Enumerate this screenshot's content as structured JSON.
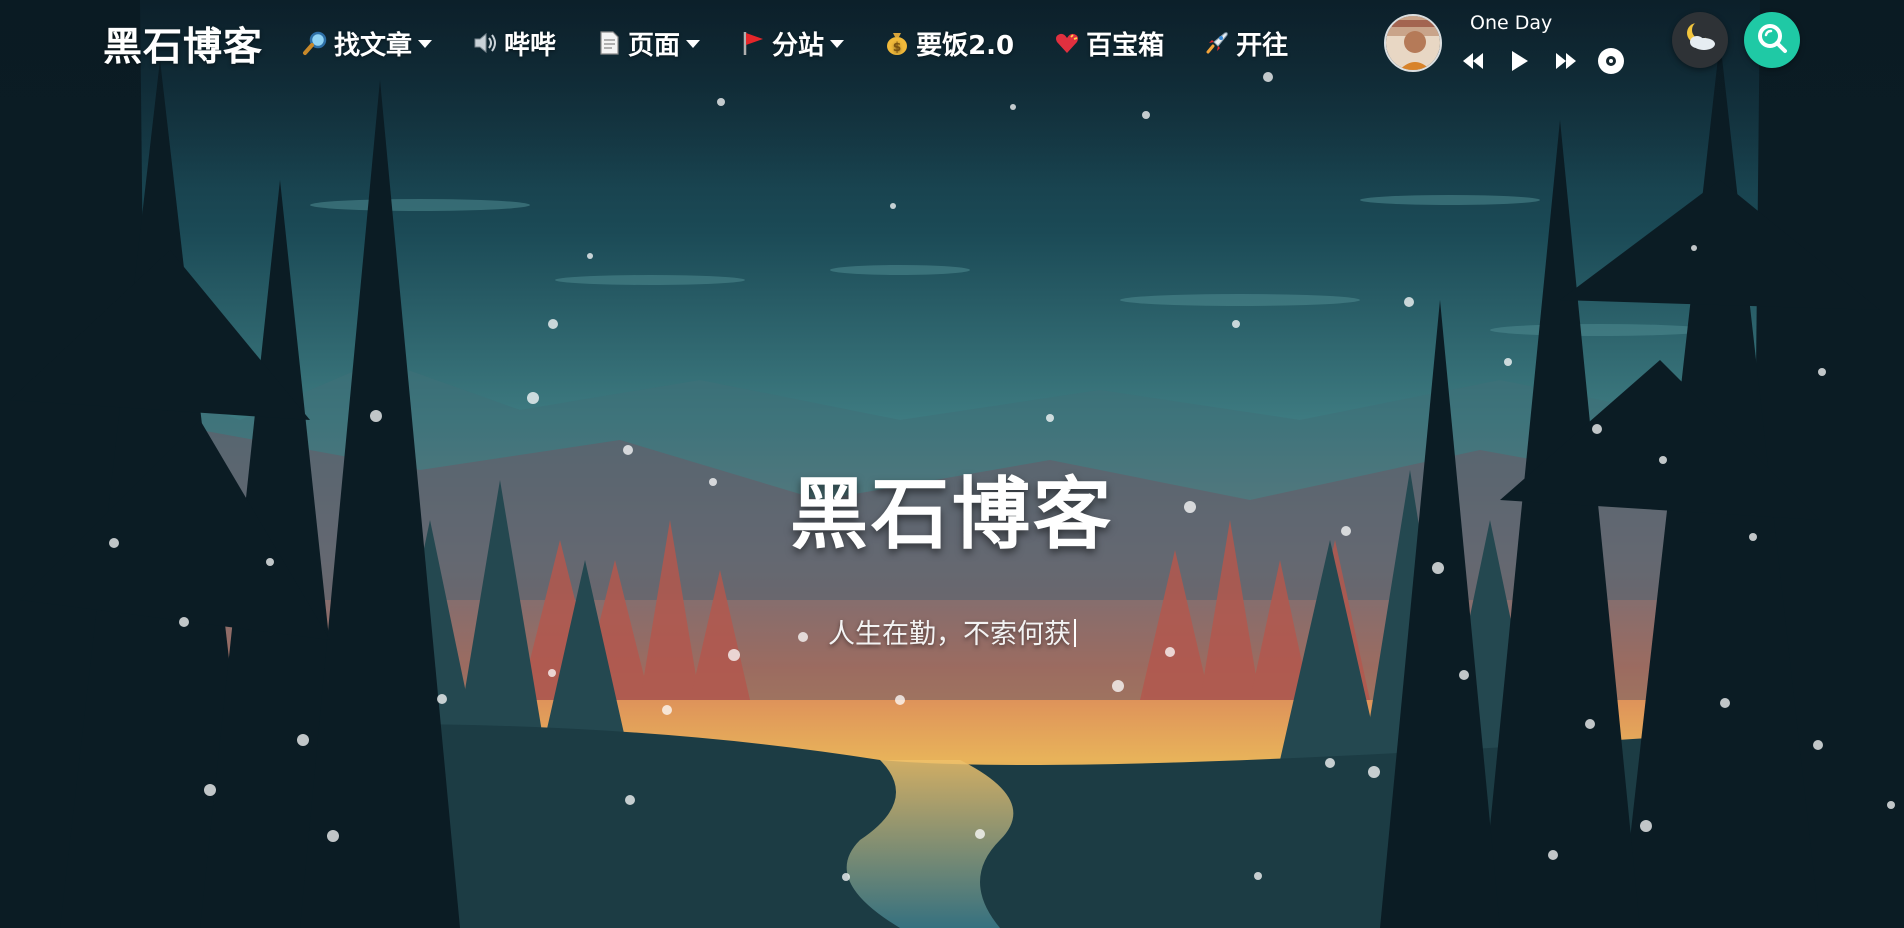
{
  "brand": {
    "title": "黑石博客"
  },
  "menu": [
    {
      "label": "找文章",
      "icon": "magnifier-icon",
      "has_dropdown": true
    },
    {
      "label": "哔哔",
      "icon": "speaker-icon",
      "has_dropdown": false
    },
    {
      "label": "页面",
      "icon": "page-icon",
      "has_dropdown": true
    },
    {
      "label": "分站",
      "icon": "flag-icon",
      "has_dropdown": true
    },
    {
      "label": "要饭2.0",
      "icon": "money-bag-icon",
      "has_dropdown": false
    },
    {
      "label": "百宝箱",
      "icon": "heart-icon",
      "has_dropdown": false
    },
    {
      "label": "开往",
      "icon": "rocket-icon",
      "has_dropdown": false
    }
  ],
  "player": {
    "song_title": "One Day",
    "controls": [
      "previous-icon",
      "play-icon",
      "next-icon",
      "disc-icon"
    ]
  },
  "actions": {
    "theme_toggle_icon": "weather-moon-icon",
    "search_icon": "search-icon"
  },
  "hero": {
    "title": "黑石博客",
    "subtitle": "人生在勤，不索何获"
  },
  "colors": {
    "search_accent": "#1fc9a5",
    "sky_top": "#0f2a38",
    "sunset": "#e89a5a"
  }
}
